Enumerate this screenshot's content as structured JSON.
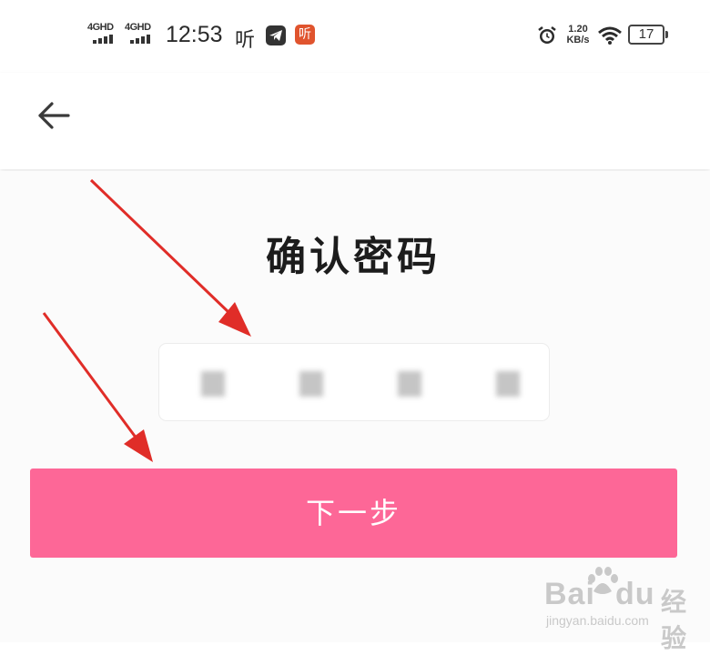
{
  "status_bar": {
    "signal_1_label": "4GHD",
    "signal_2_label": "4GHD",
    "time": "12:53",
    "notif_ting": "听",
    "notif_ting_badge": "听",
    "net_speed_value": "1.20",
    "net_speed_unit": "KB/s",
    "battery_level": "17",
    "icons": [
      "signal-icon",
      "signal-icon",
      "telegram-icon",
      "alarm-icon",
      "wifi-icon",
      "battery-icon"
    ]
  },
  "nav": {
    "back_icon": "arrow-left-icon"
  },
  "main": {
    "title": "确认密码",
    "password_digits_shown": 4,
    "next_button_label": "下一步"
  },
  "watermark": {
    "logo": "Bai",
    "logo_suffix": "du",
    "brand_cn": "经验",
    "url": "jingyan.baidu.com"
  },
  "colors": {
    "accent": "#fd6797",
    "arrow": "#e02d28",
    "title_text": "#1c1c1c",
    "background": "#fbfbfb"
  }
}
